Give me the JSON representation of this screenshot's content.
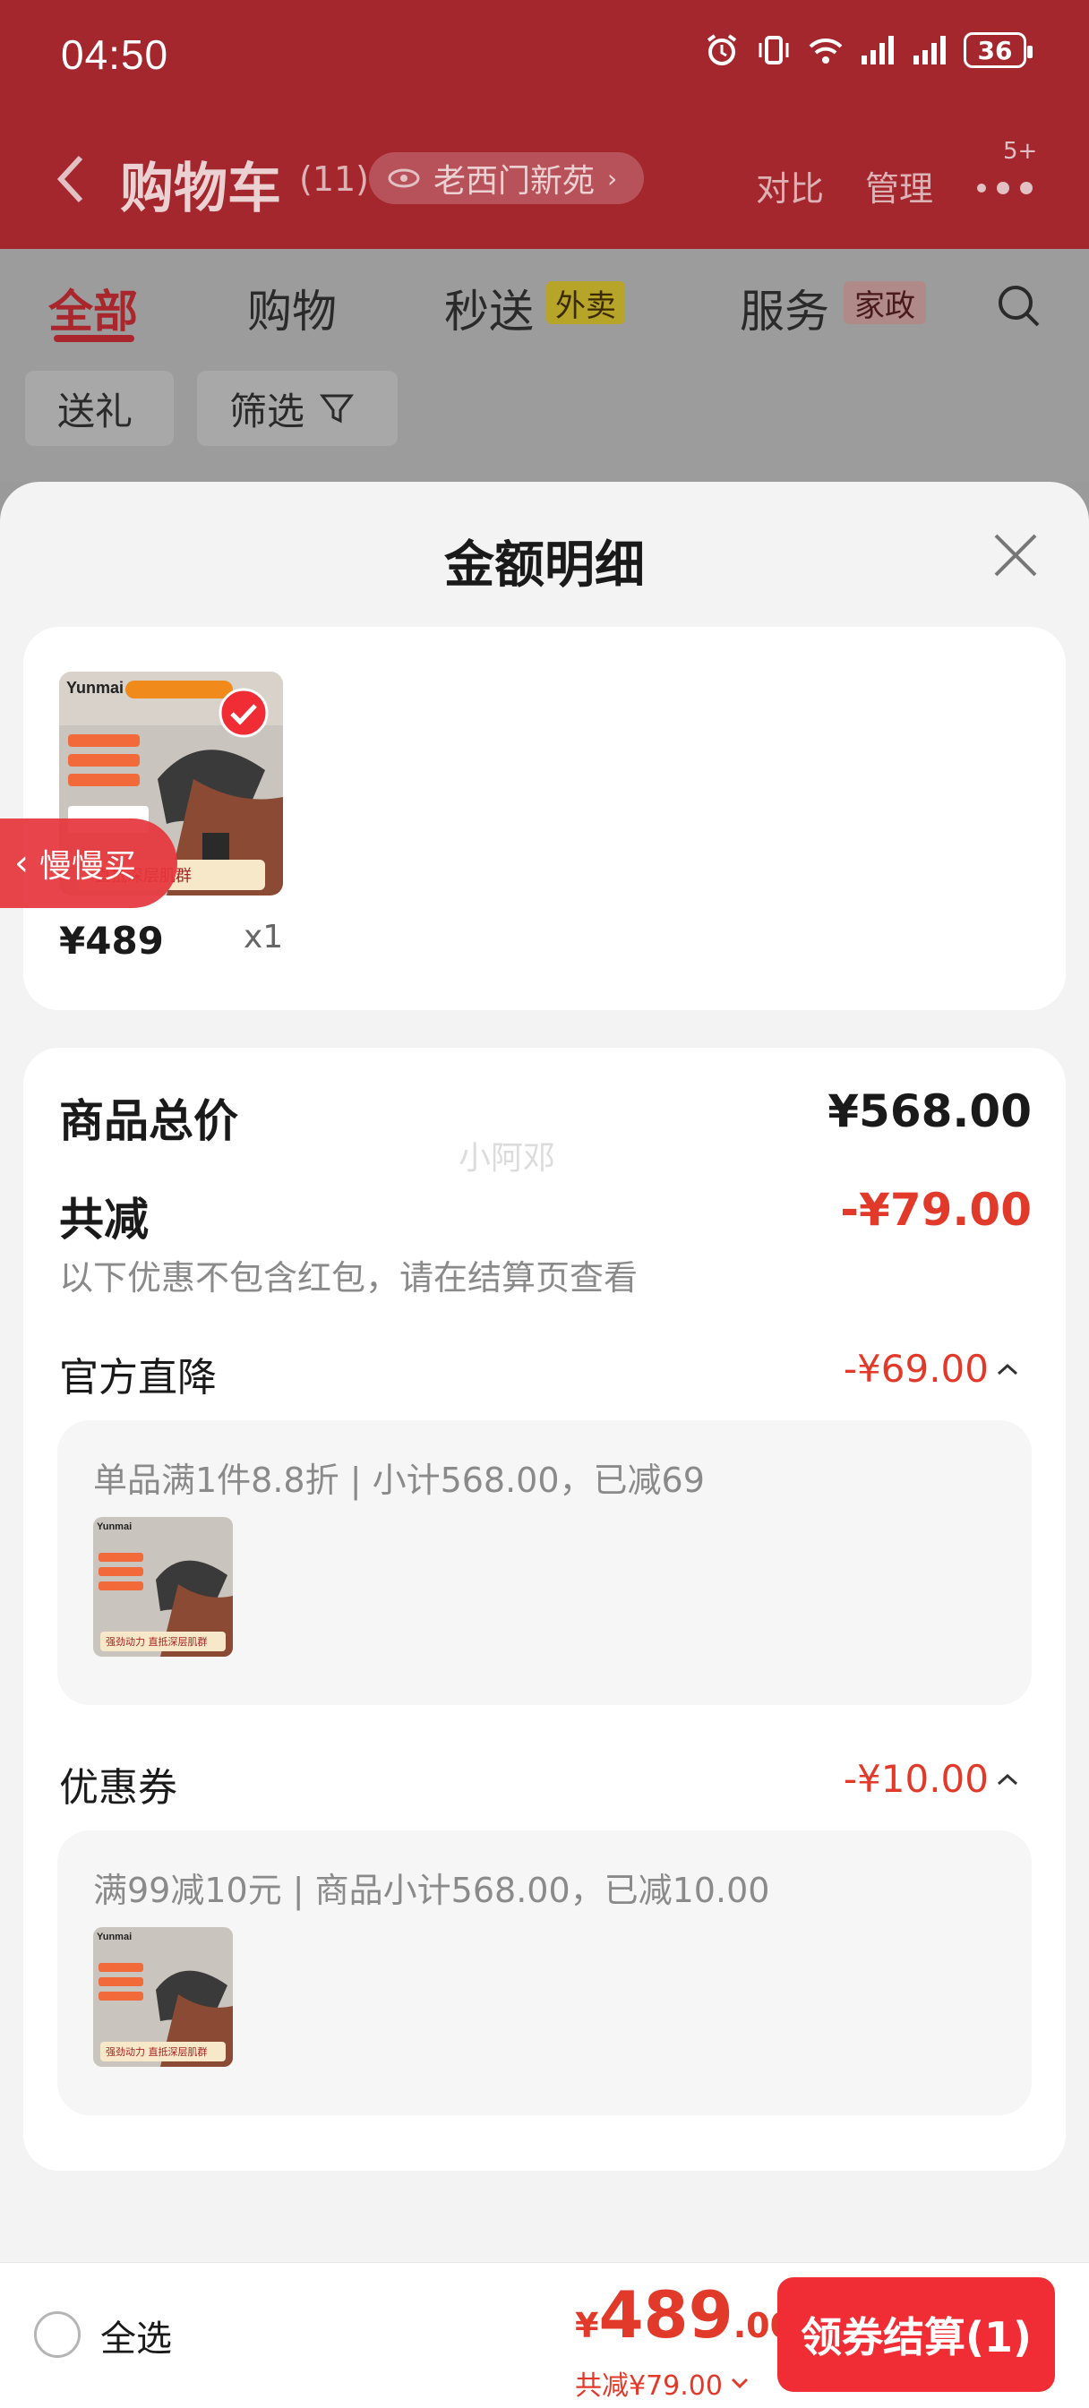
{
  "status_bar": {
    "time": "04:50",
    "battery": "36"
  },
  "header": {
    "title": "购物车",
    "count": "(11)",
    "location": "老西门新苑",
    "compare": "对比",
    "manage": "管理",
    "notif_badge": "5+"
  },
  "tabs": {
    "all": "全部",
    "shopping": "购物",
    "flash": "秒送",
    "flash_tag": "外卖",
    "service": "服务",
    "service_tag": "家政"
  },
  "chips": {
    "gift": "送礼",
    "filter": "筛选"
  },
  "sheet": {
    "title": "金额明细",
    "product": {
      "price": "¥489",
      "qty": "x1",
      "brand": "Yunmai",
      "img_caption": "直抵深层肌群",
      "thumb_caption": "强劲动力 直抵深层肌群"
    },
    "slow_buy": "慢慢买",
    "watermark": "小阿邓",
    "total_label": "商品总价",
    "total_value": "¥568.00",
    "reduce_label": "共减",
    "reduce_value": "-¥79.00",
    "reduce_note": "以下优惠不包含红包，请在结算页查看",
    "official": {
      "label": "官方直降",
      "value": "-¥69.00",
      "detail": "单品满1件8.8折 | 小计568.00，已减69"
    },
    "coupon": {
      "label": "优惠券",
      "value": "-¥10.00",
      "detail": "满99减10元 | 商品小计568.00，已减10.00"
    }
  },
  "bottom": {
    "select_all": "全选",
    "currency": "¥",
    "price_int": "489",
    "price_dec": ".00",
    "saving": "共减¥79.00",
    "checkout": "领券结算(1)"
  },
  "colors": {
    "accent_red": "#e23a2a",
    "button_red": "#f02c34",
    "header_red": "#a4272e"
  }
}
